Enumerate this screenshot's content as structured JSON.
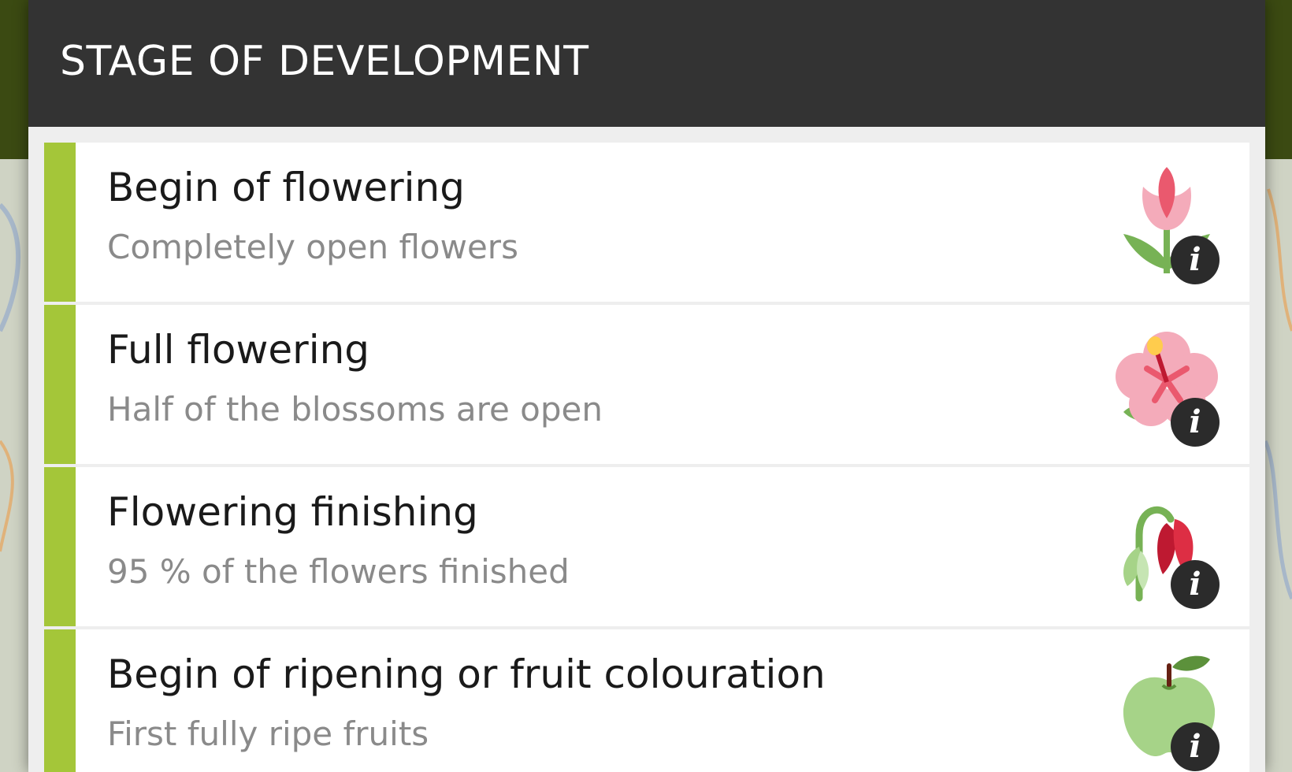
{
  "dialog": {
    "title": "STAGE OF DEVELOPMENT"
  },
  "stages": [
    {
      "title": "Begin of flowering",
      "subtitle": "Completely open flowers",
      "icon": "tulip-icon",
      "info": "i"
    },
    {
      "title": "Full flowering",
      "subtitle": "Half of the blossoms are open",
      "icon": "hibiscus-icon",
      "info": "i"
    },
    {
      "title": "Flowering finishing",
      "subtitle": "95 % of the flowers finished",
      "icon": "wilted-flower-icon",
      "info": "i"
    },
    {
      "title": "Begin of ripening or fruit colouration",
      "subtitle": "First fully ripe fruits",
      "icon": "green-apple-icon",
      "info": "i"
    }
  ],
  "colors": {
    "accent": "#a4c639",
    "title_bar": "#333333",
    "info_badge": "#2b2b2b"
  }
}
